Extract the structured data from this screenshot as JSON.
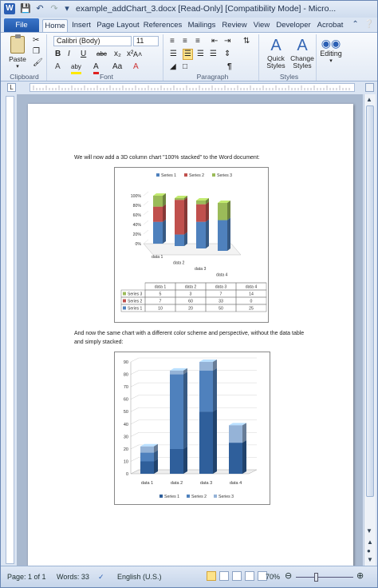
{
  "window": {
    "title": "example_addChart_3.docx [Read-Only] [Compatibility Mode]  -  Micro...",
    "app_icon": "W",
    "qat": [
      "save-icon",
      "undo-icon",
      "redo-icon",
      "customize-icon"
    ]
  },
  "tabs": [
    {
      "label": "File"
    },
    {
      "label": "Home"
    },
    {
      "label": "Insert"
    },
    {
      "label": "Page Layout"
    },
    {
      "label": "References"
    },
    {
      "label": "Mailings"
    },
    {
      "label": "Review"
    },
    {
      "label": "View"
    },
    {
      "label": "Developer"
    },
    {
      "label": "Acrobat"
    }
  ],
  "ribbon": {
    "clipboard": {
      "paste_label": "Paste",
      "group_label": "Clipboard"
    },
    "font": {
      "font_name": "Calibri (Body)",
      "font_size": "11",
      "group_label": "Font",
      "bold": "B",
      "italic": "I",
      "underline": "U",
      "strike": "abc",
      "sub": "x₂",
      "sup": "x²",
      "grow": "A˄",
      "color": "A",
      "highlight": "aby",
      "case": "Aa",
      "clear": "A"
    },
    "paragraph": {
      "group_label": "Paragraph",
      "pilcrow": "¶"
    },
    "styles": {
      "quick_label_1": "Quick",
      "quick_label_2": "Styles",
      "change_label_1": "Change",
      "change_label_2": "Styles",
      "group_label": "Styles"
    },
    "editing": {
      "label": "Editing"
    }
  },
  "document": {
    "para1": "We will now add a 3D column chart \"100% stacked\" to the Word document:",
    "para2a": "And now the same chart with a different color scheme and perspective, without the data table",
    "para2b": "and simply stacked:"
  },
  "chart_data": [
    {
      "type": "bar",
      "subtype": "3d-100%-stacked",
      "categories": [
        "data 1",
        "data 2",
        "data 3",
        "data 4"
      ],
      "series": [
        {
          "name": "Series 1",
          "values": [
            10,
            20,
            50,
            25
          ],
          "color": "#4f81bd"
        },
        {
          "name": "Series 2",
          "values": [
            7,
            60,
            33,
            0
          ],
          "color": "#c0504d"
        },
        {
          "name": "Series 3",
          "values": [
            5,
            3,
            7,
            14
          ],
          "color": "#9bbb59"
        }
      ],
      "y_ticks": [
        "0%",
        "20%",
        "40%",
        "60%",
        "80%",
        "100%"
      ],
      "legend": "top",
      "data_table": true,
      "table_header": [
        "data 1",
        "data 2",
        "data 3",
        "data 4"
      ]
    },
    {
      "type": "bar",
      "subtype": "3d-stacked",
      "categories": [
        "data 1",
        "data 2",
        "data 3",
        "data 4"
      ],
      "series": [
        {
          "name": "Series 1",
          "values": [
            10,
            20,
            50,
            25
          ],
          "color": "#2f5f9b"
        },
        {
          "name": "Series 2",
          "values": [
            7,
            60,
            33,
            0
          ],
          "color": "#4f81bd"
        },
        {
          "name": "Series 3",
          "values": [
            5,
            3,
            7,
            14
          ],
          "color": "#95b3d7"
        }
      ],
      "y_ticks": [
        "0",
        "10",
        "20",
        "30",
        "40",
        "50",
        "60",
        "70",
        "80",
        "90"
      ],
      "ylim": [
        0,
        90
      ],
      "legend": "bottom",
      "grid": true
    }
  ],
  "status": {
    "page": "Page: 1 of 1",
    "words": "Words: 33",
    "language": "English (U.S.)",
    "zoom": "70%"
  }
}
